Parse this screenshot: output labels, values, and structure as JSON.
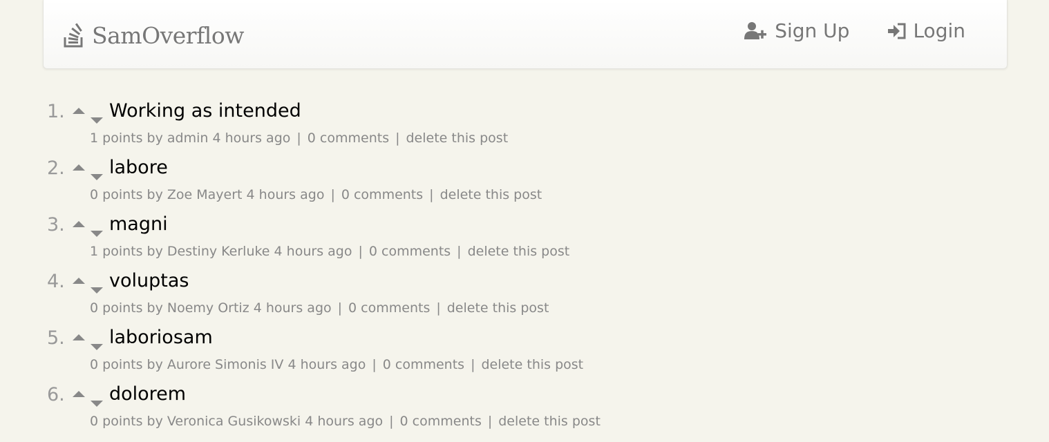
{
  "header": {
    "brand": "SamOverflow",
    "brand_icon": "stack-overflow-icon",
    "nav": [
      {
        "label": "Sign Up",
        "icon": "user-plus-icon"
      },
      {
        "label": "Login",
        "icon": "sign-in-icon"
      }
    ]
  },
  "posts": [
    {
      "rank": "1.",
      "title": "Working as intended",
      "points": "1 points by",
      "author": "admin",
      "time": "4 hours ago",
      "comments": "0 comments",
      "delete": "delete this post"
    },
    {
      "rank": "2.",
      "title": "labore",
      "points": "0 points by",
      "author": "Zoe Mayert",
      "time": "4 hours ago",
      "comments": "0 comments",
      "delete": "delete this post"
    },
    {
      "rank": "3.",
      "title": "magni",
      "points": "1 points by",
      "author": "Destiny Kerluke",
      "time": "4 hours ago",
      "comments": "0 comments",
      "delete": "delete this post"
    },
    {
      "rank": "4.",
      "title": "voluptas",
      "points": "0 points by",
      "author": "Noemy Ortiz",
      "time": "4 hours ago",
      "comments": "0 comments",
      "delete": "delete this post"
    },
    {
      "rank": "5.",
      "title": "laboriosam",
      "points": "0 points by",
      "author": "Aurore Simonis IV",
      "time": "4 hours ago",
      "comments": "0 comments",
      "delete": "delete this post"
    },
    {
      "rank": "6.",
      "title": "dolorem",
      "points": "0 points by",
      "author": "Veronica Gusikowski",
      "time": "4 hours ago",
      "comments": "0 comments",
      "delete": "delete this post"
    }
  ],
  "separator": "|",
  "colors": {
    "background": "#f5f4ec",
    "title": "#000000",
    "muted": "#888888"
  }
}
